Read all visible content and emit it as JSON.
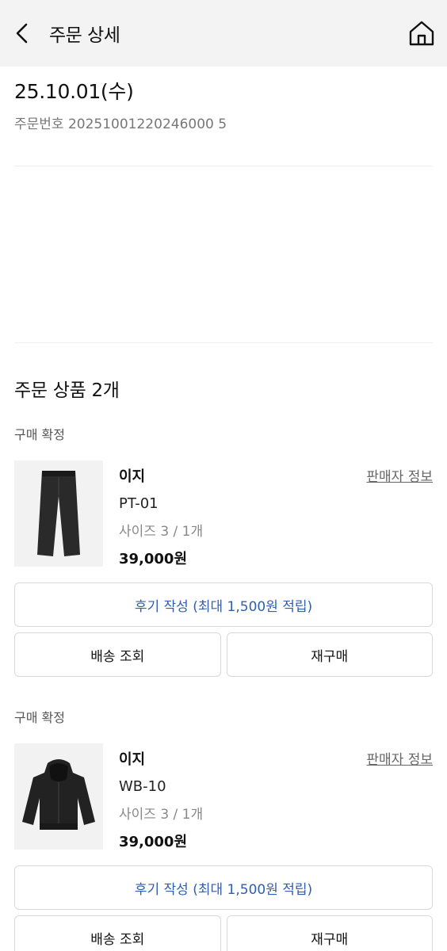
{
  "header": {
    "title": "주문 상세",
    "back_icon": "chevron-left-icon",
    "home_icon": "home-icon"
  },
  "order": {
    "date": "25.10.01(수)",
    "number": "주문번호 20251001220246000 5"
  },
  "products_section": {
    "title": "주문 상품 2개",
    "items": [
      {
        "status": "구매 확정",
        "brand": "이지",
        "name": "PT-01",
        "option": "사이즈 3 / 1개",
        "price": "39,000원",
        "seller_link": "판매자 정보",
        "review_label": "후기 작성 (최대 1,500원 적립)",
        "shipping_label": "배송 조회",
        "reorder_label": "재구매",
        "image_icon": "pants-icon"
      },
      {
        "status": "구매 확정",
        "brand": "이지",
        "name": "WB-10",
        "option": "사이즈 3 / 1개",
        "price": "39,000원",
        "seller_link": "판매자 정보",
        "review_label": "후기 작성 (최대 1,500원 적립)",
        "shipping_label": "배송 조회",
        "reorder_label": "재구매",
        "image_icon": "hoodie-icon"
      }
    ]
  },
  "colors": {
    "header_bg": "#f3f3f3",
    "review_text": "#2f5fb3",
    "border": "#d9d9d9"
  }
}
